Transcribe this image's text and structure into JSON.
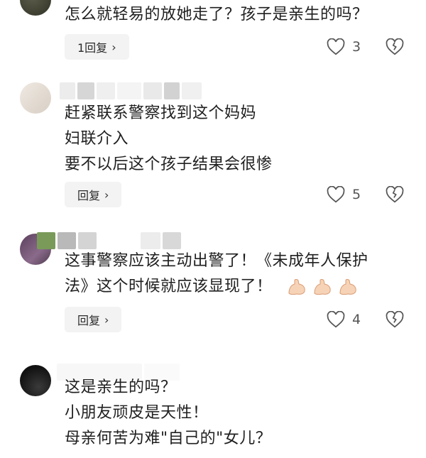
{
  "comments": [
    {
      "lines": [
        "怎么就轻易的放她走了？孩子是亲生的吗？"
      ],
      "reply_label": "1回复",
      "likes": "3"
    },
    {
      "lines": [
        "赶紧联系警察找到这个妈妈",
        "妇联介入",
        "要不以后这个孩子结果会很惨"
      ],
      "reply_label": "回复",
      "likes": "5"
    },
    {
      "lines": [
        "这事警察应该主动出警了！《未成年人保护",
        "法》这个时候就应该显现了！"
      ],
      "reply_label": "回复",
      "likes": "4",
      "emoji": [
        "flexed-biceps",
        "flexed-biceps",
        "flexed-biceps"
      ]
    },
    {
      "lines": [
        "这是亲生的吗？",
        "小朋友顽皮是天性！",
        "母亲何苦为难\"自己的\"女儿？"
      ]
    }
  ],
  "icons": {
    "like": "heart-outline-icon",
    "dislike": "broken-heart-icon",
    "reply_chevron": "chevron-right-icon"
  }
}
